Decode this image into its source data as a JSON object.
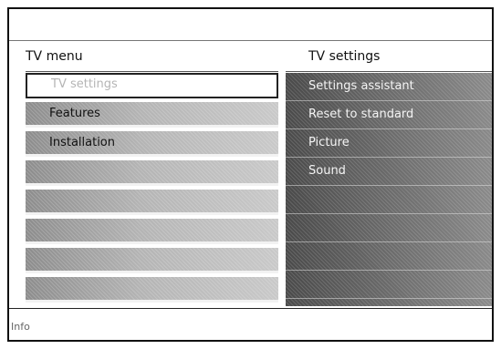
{
  "menu": {
    "left_title": "TV menu",
    "right_title": "TV settings",
    "left_items": [
      {
        "label": "TV settings",
        "selected": true
      },
      {
        "label": "Features",
        "selected": false
      },
      {
        "label": "Installation",
        "selected": false
      },
      {
        "label": "",
        "selected": false
      },
      {
        "label": "",
        "selected": false
      },
      {
        "label": "",
        "selected": false
      },
      {
        "label": "",
        "selected": false
      },
      {
        "label": "",
        "selected": false
      }
    ],
    "right_items": [
      {
        "label": "Settings assistant"
      },
      {
        "label": "Reset to standard"
      },
      {
        "label": "Picture"
      },
      {
        "label": "Sound"
      },
      {
        "label": ""
      },
      {
        "label": ""
      },
      {
        "label": ""
      },
      {
        "label": ""
      }
    ]
  },
  "footer": {
    "info_label": "Info"
  }
}
